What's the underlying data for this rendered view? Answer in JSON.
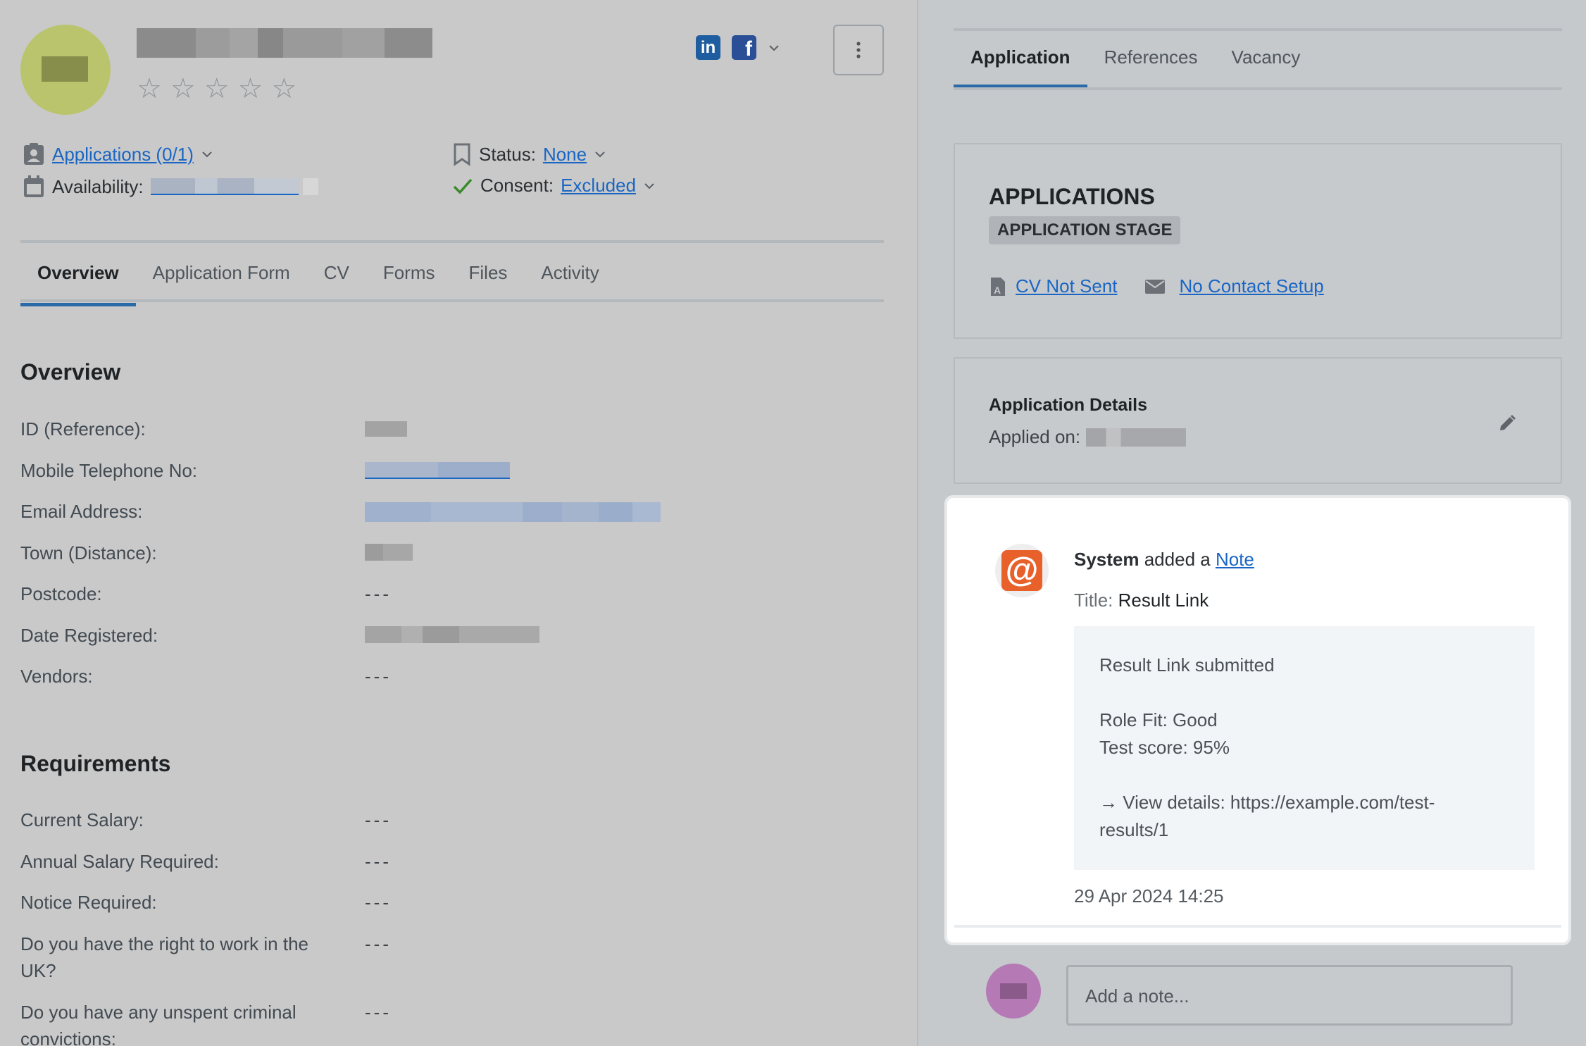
{
  "candidate": {
    "rating_stars": [
      "☆",
      "☆",
      "☆",
      "☆",
      "☆"
    ]
  },
  "social": {
    "linkedin_label": "in",
    "facebook_label": "f"
  },
  "meta": {
    "applications_link": "Applications (0/1)",
    "status_label": "Status:",
    "status_value": "None",
    "availability_label": "Availability:",
    "consent_label": "Consent:",
    "consent_value": "Excluded"
  },
  "left_tabs": [
    "Overview",
    "Application Form",
    "CV",
    "Forms",
    "Files",
    "Activity"
  ],
  "overview": {
    "heading": "Overview",
    "fields": [
      {
        "label": "ID (Reference):",
        "value": ""
      },
      {
        "label": "Mobile Telephone No:",
        "value": ""
      },
      {
        "label": "Email Address:",
        "value": ""
      },
      {
        "label": "Town (Distance):",
        "value": ""
      },
      {
        "label": "Postcode:",
        "value": "---"
      },
      {
        "label": "Date Registered:",
        "value": ""
      },
      {
        "label": "Vendors:",
        "value": "---"
      }
    ]
  },
  "requirements": {
    "heading": "Requirements",
    "fields": [
      {
        "label": "Current Salary:",
        "value": "---"
      },
      {
        "label": "Annual Salary Required:",
        "value": "---"
      },
      {
        "label": "Notice Required:",
        "value": "---"
      },
      {
        "label": "Do you have the right to work in the UK?",
        "value": "---"
      },
      {
        "label": "Do you have any unspent criminal convictions:",
        "value": "---"
      }
    ]
  },
  "right_tabs": [
    "Application",
    "References",
    "Vacancy"
  ],
  "applications_card": {
    "title": "APPLICATIONS",
    "stage": "APPLICATION STAGE",
    "cv_link": "CV Not Sent",
    "contact_link": "No Contact Setup"
  },
  "details_card": {
    "title": "Application Details",
    "applied_label": "Applied on:"
  },
  "note": {
    "author": "System",
    "action": " added a ",
    "type_link": "Note",
    "title_label": "Title:",
    "title_value": "Result Link",
    "body_lines": [
      "Result Link submitted",
      "",
      "Role Fit: Good",
      "Test score: 95%",
      "",
      "→ View details: https://example.com/test-",
      "results/1"
    ],
    "timestamp": "29 Apr 2024 14:25"
  },
  "add_note": {
    "placeholder": "Add a note..."
  },
  "colors": {
    "accent": "#2a6aa8",
    "link": "#1a66c4",
    "system_avatar": "#e8602a"
  }
}
